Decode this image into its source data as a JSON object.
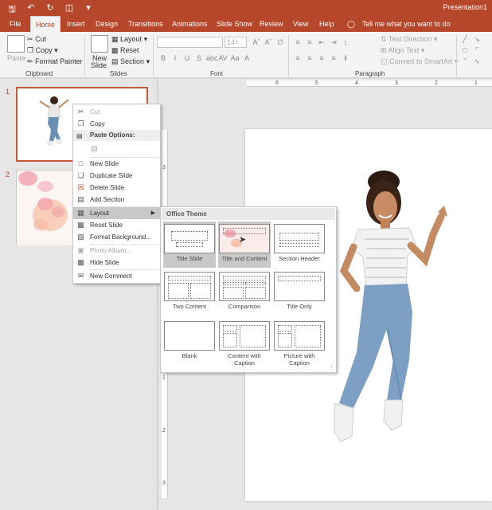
{
  "window": {
    "doc_title": "Presentation1"
  },
  "qat": {
    "save_icon": "save-icon",
    "undo_icon": "undo-icon",
    "redo_icon": "redo-icon",
    "start_icon": "start-from-beginning-icon",
    "customize_icon": "customize-qat-icon"
  },
  "tabs": [
    "File",
    "Home",
    "Insert",
    "Design",
    "Transitions",
    "Animations",
    "Slide Show",
    "Review",
    "View",
    "Help"
  ],
  "tellme": "Tell me what you want to do",
  "ribbon": {
    "clipboard": {
      "paste": "Paste",
      "cut": "Cut",
      "copy": "Copy",
      "format_painter": "Format Painter",
      "label": "Clipboard"
    },
    "slides": {
      "new_slide_1": "New",
      "new_slide_2": "Slide",
      "layout": "Layout",
      "reset": "Reset",
      "section": "Section",
      "label": "Slides"
    },
    "font": {
      "font_size": "14+",
      "label": "Font",
      "buttons": [
        "B",
        "I",
        "U",
        "S",
        "abc",
        "AV",
        "Aa",
        "A"
      ]
    },
    "paragraph": {
      "text_direction": "Text Direction",
      "align_text": "Align Text",
      "convert_smartart": "Convert to SmartArt",
      "label": "Paragraph"
    }
  },
  "slides": [
    {
      "number": "1"
    },
    {
      "number": "2"
    }
  ],
  "ruler": {
    "h": [
      "6",
      "5",
      "4",
      "3",
      "2",
      "1",
      "0"
    ],
    "v": [
      "3",
      "2",
      "1",
      "0",
      "1",
      "2",
      "3"
    ]
  },
  "context_menu": {
    "cut": "Cut",
    "copy": "Copy",
    "paste_options": "Paste Options:",
    "new_slide": "New Slide",
    "duplicate_slide": "Duplicate Slide",
    "delete_slide": "Delete Slide",
    "add_section": "Add Section",
    "layout": "Layout",
    "reset_slide": "Reset Slide",
    "format_background": "Format Background...",
    "photo_album": "Photo Album...",
    "hide_slide": "Hide Slide",
    "new_comment": "New Comment"
  },
  "layout_submenu": {
    "header": "Office Theme",
    "items": [
      {
        "label1": "Title Slide",
        "label2": ""
      },
      {
        "label1": "Title and Content",
        "label2": ""
      },
      {
        "label1": "Section Header",
        "label2": ""
      },
      {
        "label1": "Two Content",
        "label2": ""
      },
      {
        "label1": "Comparison",
        "label2": ""
      },
      {
        "label1": "Title Only",
        "label2": ""
      },
      {
        "label1": "Blank",
        "label2": ""
      },
      {
        "label1": "Content with",
        "label2": "Caption"
      },
      {
        "label1": "Picture with",
        "label2": "Caption"
      }
    ]
  },
  "colors": {
    "accent": "#b7472a",
    "selection": "#c55a3a",
    "highlight": "#c8c8c8"
  }
}
